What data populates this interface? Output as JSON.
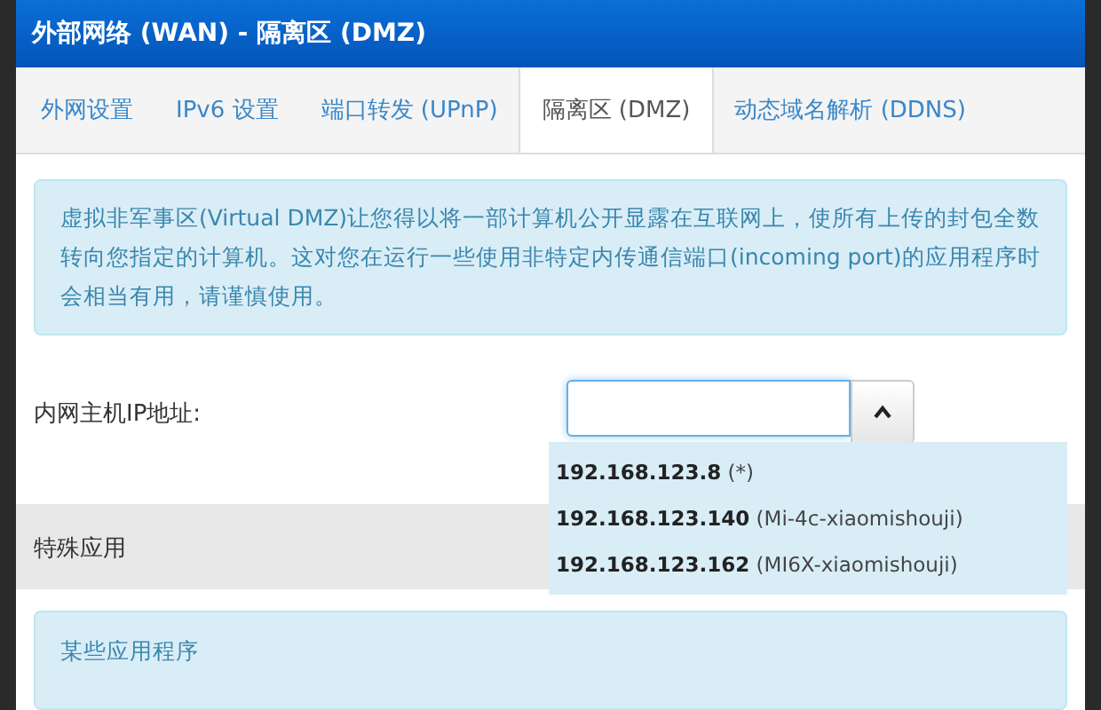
{
  "window": {
    "title": "外部网络 (WAN) - 隔离区 (DMZ)"
  },
  "tabs": [
    {
      "label": "外网设置",
      "selected": false
    },
    {
      "label": "IPv6 设置",
      "selected": false
    },
    {
      "label": "端口转发 (UPnP)",
      "selected": false
    },
    {
      "label": "隔离区 (DMZ)",
      "selected": true
    },
    {
      "label": "动态域名解析 (DDNS)",
      "selected": false
    }
  ],
  "info": "虚拟非军事区(Virtual DMZ)让您得以将一部计算机公开显露在互联网上，使所有上传的封包全数转向您指定的计算机。这对您在运行一些使用非特定内传通信端口(incoming port)的应用程序时会相当有用，请谨慎使用。",
  "host_ip": {
    "label": "内网主机IP地址:",
    "expanded": true,
    "options": [
      {
        "ip": "192.168.123.8",
        "name": "(*)"
      },
      {
        "ip": "192.168.123.140",
        "name": "(Mi-4c-xiaomishouji)"
      },
      {
        "ip": "192.168.123.162",
        "name": "(MI6X-xiaomishouji)"
      }
    ]
  },
  "special": {
    "title": "特殊应用",
    "info": "某些应用程序"
  }
}
